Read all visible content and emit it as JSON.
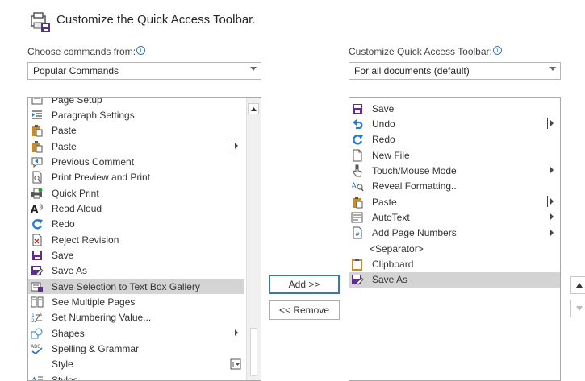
{
  "header": {
    "title": "Customize the Quick Access Toolbar.",
    "icon": "quick-access-toolbar-icon"
  },
  "left": {
    "label": "Choose commands from:",
    "label_info": "i",
    "dropdown_value": "Popular Commands",
    "items": [
      {
        "label": "Page Setup",
        "icon": "page-setup-icon",
        "submenu": "none"
      },
      {
        "label": "Paragraph Settings",
        "icon": "paragraph-settings-icon",
        "submenu": "none"
      },
      {
        "label": "Paste",
        "icon": "paste-icon",
        "submenu": "none"
      },
      {
        "label": "Paste",
        "icon": "paste-icon",
        "submenu": "split"
      },
      {
        "label": "Previous Comment",
        "icon": "previous-comment-icon",
        "submenu": "none"
      },
      {
        "label": "Print Preview and Print",
        "icon": "print-preview-icon",
        "submenu": "none"
      },
      {
        "label": "Quick Print",
        "icon": "quick-print-icon",
        "submenu": "none"
      },
      {
        "label": "Read Aloud",
        "icon": "read-aloud-icon",
        "submenu": "none"
      },
      {
        "label": "Redo",
        "icon": "redo-icon",
        "submenu": "none"
      },
      {
        "label": "Reject Revision",
        "icon": "reject-revision-icon",
        "submenu": "none"
      },
      {
        "label": "Save",
        "icon": "save-icon",
        "submenu": "none"
      },
      {
        "label": "Save As",
        "icon": "save-as-icon",
        "submenu": "none"
      },
      {
        "label": "Save Selection to Text Box Gallery",
        "icon": "text-box-gallery-icon",
        "submenu": "none",
        "selected": true
      },
      {
        "label": "See Multiple Pages",
        "icon": "multiple-pages-icon",
        "submenu": "none"
      },
      {
        "label": "Set Numbering Value...",
        "icon": "numbering-value-icon",
        "submenu": "none"
      },
      {
        "label": "Shapes",
        "icon": "shapes-icon",
        "submenu": "arrow"
      },
      {
        "label": "Spelling & Grammar",
        "icon": "spelling-grammar-icon",
        "submenu": "none"
      },
      {
        "label": "Style",
        "icon": "none",
        "submenu": "none",
        "trailing": "style-box-icon"
      },
      {
        "label": "Styles...",
        "icon": "styles-icon",
        "submenu": "none"
      }
    ]
  },
  "middle": {
    "add_label": "Add >>",
    "remove_label": "<< Remove"
  },
  "right": {
    "label": "Customize Quick Access Toolbar:",
    "label_info": "i",
    "dropdown_value": "For all documents (default)",
    "items": [
      {
        "label": "Save",
        "icon": "save-icon",
        "submenu": "none"
      },
      {
        "label": "Undo",
        "icon": "undo-icon",
        "submenu": "split"
      },
      {
        "label": "Redo",
        "icon": "redo-icon",
        "submenu": "none"
      },
      {
        "label": "New File",
        "icon": "new-file-icon",
        "submenu": "none"
      },
      {
        "label": "Touch/Mouse Mode",
        "icon": "touch-mouse-icon",
        "submenu": "arrow"
      },
      {
        "label": "Reveal Formatting...",
        "icon": "reveal-formatting-icon",
        "submenu": "none"
      },
      {
        "label": "Paste",
        "icon": "paste-icon",
        "submenu": "split"
      },
      {
        "label": "AutoText",
        "icon": "autotext-icon",
        "submenu": "arrow"
      },
      {
        "label": "Add Page Numbers",
        "icon": "page-numbers-icon",
        "submenu": "arrow"
      },
      {
        "label": "<Separator>",
        "icon": "none",
        "submenu": "none"
      },
      {
        "label": "Clipboard",
        "icon": "clipboard-icon",
        "submenu": "none"
      },
      {
        "label": "Save As",
        "icon": "save-as-icon",
        "submenu": "none",
        "selected": true
      }
    ]
  },
  "colors": {
    "selection": "#d4d4d4",
    "accent": "#2b79d0",
    "save_purple": "#5c2d91"
  }
}
